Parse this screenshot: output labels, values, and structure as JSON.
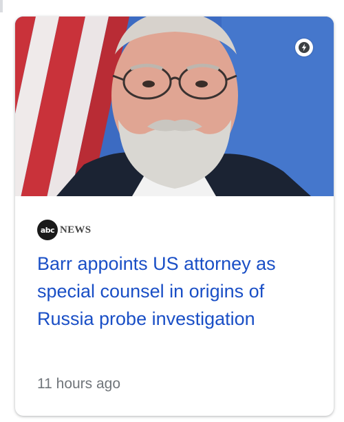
{
  "card": {
    "source": {
      "logo_text": "abc",
      "name": "NEWS"
    },
    "headline": "Barr appoints US attorney as special counsel in origins of Russia probe investigation",
    "timestamp": "11 hours ago",
    "amp_icon": "lightning-bolt-icon",
    "image_alt": "news-photo"
  },
  "colors": {
    "headline": "#1a4fc6",
    "timestamp": "#70757a",
    "card_bg": "#ffffff"
  }
}
